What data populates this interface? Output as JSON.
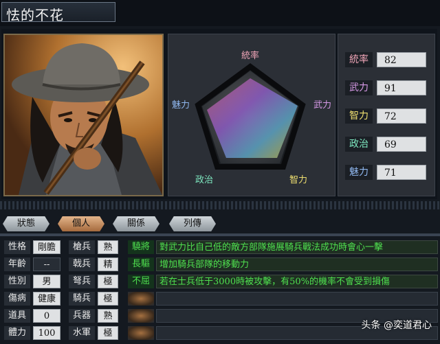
{
  "header": {
    "name": "怯的不花"
  },
  "radar": {
    "labels": {
      "top": "統率",
      "right": "武力",
      "bottom_right": "智力",
      "bottom_left": "政治",
      "left": "魅力"
    }
  },
  "stats": [
    {
      "label": "統率",
      "value": "82",
      "color": "#f0a6b8"
    },
    {
      "label": "武力",
      "value": "91",
      "color": "#d89ae8"
    },
    {
      "label": "智力",
      "value": "72",
      "color": "#f0e070"
    },
    {
      "label": "政治",
      "value": "69",
      "color": "#7ee8c0"
    },
    {
      "label": "魅力",
      "value": "71",
      "color": "#90b8f0"
    }
  ],
  "tabs": [
    {
      "label": "狀態",
      "active": false
    },
    {
      "label": "個人",
      "active": true
    },
    {
      "label": "關係",
      "active": false
    },
    {
      "label": "列傳",
      "active": false
    }
  ],
  "attributes": [
    {
      "label": "性格",
      "value": "剛膽"
    },
    {
      "label": "年齡",
      "value": "--"
    },
    {
      "label": "性別",
      "value": "男"
    },
    {
      "label": "傷病",
      "value": "健康"
    },
    {
      "label": "道具",
      "value": "0"
    },
    {
      "label": "體力",
      "value": "100"
    }
  ],
  "aptitudes": [
    {
      "label": "槍兵",
      "value": "熟"
    },
    {
      "label": "戟兵",
      "value": "精"
    },
    {
      "label": "弩兵",
      "value": "極"
    },
    {
      "label": "騎兵",
      "value": "極"
    },
    {
      "label": "兵器",
      "value": "熟"
    },
    {
      "label": "水軍",
      "value": "極"
    }
  ],
  "skills": [
    {
      "name": "驍將",
      "desc": "對武力比自己低的敵方部隊施展騎兵戰法成功時會心一擊"
    },
    {
      "name": "長驅",
      "desc": "增加騎兵部隊的移動力"
    },
    {
      "name": "不屈",
      "desc": "若在士兵低于3000時被攻擊，有50%的機率不會受到損傷"
    },
    {
      "name": "",
      "desc": ""
    },
    {
      "name": "",
      "desc": ""
    },
    {
      "name": "",
      "desc": ""
    }
  ],
  "watermark": "头条 @奕道君心"
}
